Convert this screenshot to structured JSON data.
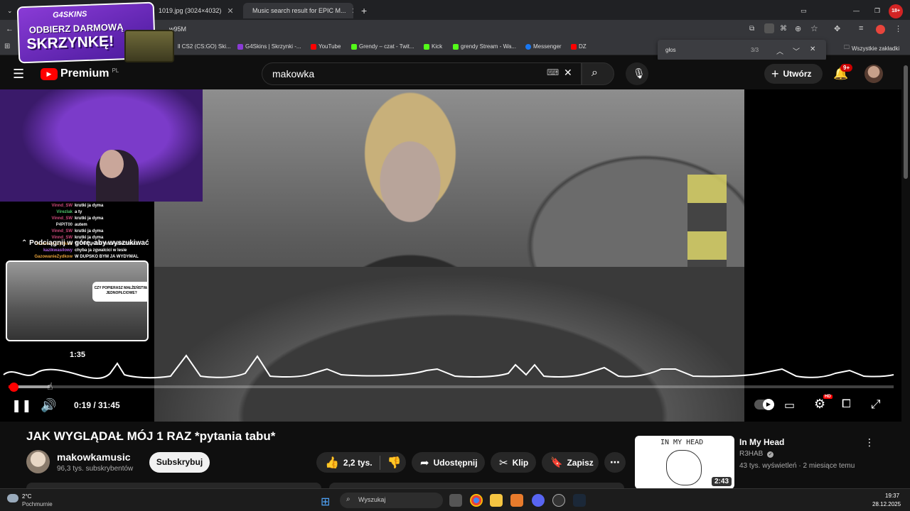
{
  "browser": {
    "tabs": [
      {
        "label": "1019.jpg (3024×4032)"
      },
      {
        "label": "Music search result for EPIC M..."
      }
    ],
    "url_fragment": "w95M",
    "bookmarks": [
      {
        "label": "ll CS2 (CS:GO) Ski..."
      },
      {
        "label": "G4Skins | Skrzynki -..."
      },
      {
        "label": "YouTube"
      },
      {
        "label": "Grendy – czat - Twit..."
      },
      {
        "label": "Kick"
      },
      {
        "label": "grendy Stream - Wa..."
      },
      {
        "label": "Messenger"
      },
      {
        "label": "DZ"
      }
    ],
    "all_bookmarks": "Wszystkie zakładki",
    "find": {
      "query": "głos",
      "count": "3/3"
    },
    "profile_badge": "18+"
  },
  "ad": {
    "brand": "G4SKINS",
    "line1": "ODBIERZ DARMOWĄ",
    "line2": "SKRZYNKĘ!"
  },
  "youtube": {
    "logo_text": "Premium",
    "region": "PL",
    "search_value": "makowka",
    "create_label": "Utwórz",
    "notif_count": "9+"
  },
  "overlay": {
    "chat": [
      {
        "user": "Vinnd_SW",
        "msg": "krutki ja dyma",
        "color": "#d04a7c"
      },
      {
        "user": "Virezlak",
        "msg": "a ty",
        "color": "#4fc56b"
      },
      {
        "user": "Vinnd_SW",
        "msg": "krutki ja dyma",
        "color": "#d04a7c"
      },
      {
        "user": "P4PIT00",
        "msg": "autem",
        "color": "#dddddd"
      },
      {
        "user": "Vinnd_SW",
        "msg": "krutki ja dyma",
        "color": "#d04a7c"
      },
      {
        "user": "Vinnd_SW",
        "msg": "krutki ja dyma",
        "color": "#d04a7c"
      },
      {
        "user": "GazowanieZydkow",
        "msg": "W DUPSKO BYM JA WYDYMAL",
        "color": "#e8a23a"
      },
      {
        "user": "kazikwasilowy",
        "msg": "chyba ja zgwalcici w lesie",
        "color": "#b060e0"
      },
      {
        "user": "GazowanieZydkow",
        "msg": "W DUPSKO BYM JA WYDYMAL",
        "color": "#e8a23a"
      }
    ],
    "pull_up": "Podciągnij w górę, aby wyszukiwać",
    "thumb_bubble": "CZY POPIERASZ MAŁŻEŃSTWA JEDNOPŁCIOWE?",
    "thumb_time": "1:35"
  },
  "player": {
    "time": "0:19 / 31:45",
    "progress_fraction": 0.01
  },
  "video": {
    "title": "JAK WYGLĄDAŁ MÓJ 1 RAZ *pytania tabu*",
    "channel": "makowkamusic",
    "subscribers": "96,3 tys. subskrybentów",
    "subscribe_label": "Subskrybuj",
    "likes": "2,2 tys.",
    "share_label": "Udostępnij",
    "clip_label": "Klip",
    "save_label": "Zapisz"
  },
  "recommendation": {
    "title": "In My Head",
    "channel": "R3HAB",
    "meta": "43 tys. wyświetleń · 2 miesiące temu",
    "duration": "2:43",
    "art_text": "IN MY HEAD"
  },
  "taskbar": {
    "weather_temp": "2°C",
    "weather_desc": "Pochmurnie",
    "search_placeholder": "Wyszukaj",
    "time": "19:37",
    "date": "28.12.2025"
  },
  "colors": {
    "accent": "#ff0000",
    "ad_purple": "#6a2bc0"
  }
}
